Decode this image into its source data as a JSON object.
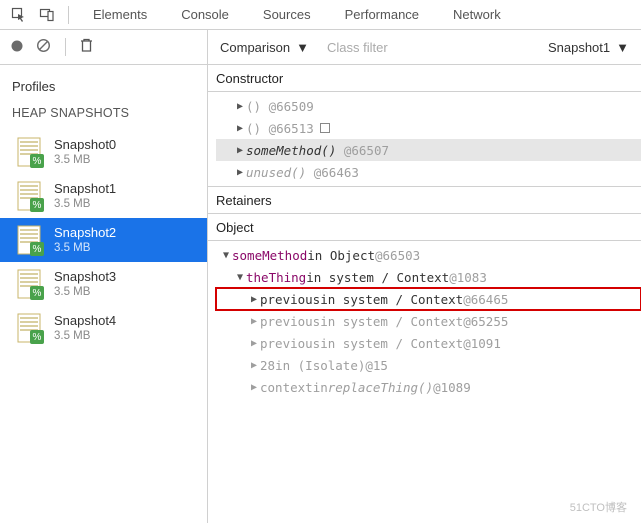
{
  "toolbar": {
    "tabs": [
      "Elements",
      "Console",
      "Sources",
      "Performance",
      "Network"
    ]
  },
  "contentToolbar": {
    "viewMode": "Comparison",
    "filterPlaceholder": "Class filter",
    "snapshotSelector": "Snapshot1"
  },
  "sidebar": {
    "profilesLabel": "Profiles",
    "heapLabel": "HEAP SNAPSHOTS",
    "snapshots": [
      {
        "name": "Snapshot0",
        "size": "3.5 MB",
        "selected": false
      },
      {
        "name": "Snapshot1",
        "size": "3.5 MB",
        "selected": false
      },
      {
        "name": "Snapshot2",
        "size": "3.5 MB",
        "selected": true
      },
      {
        "name": "Snapshot3",
        "size": "3.5 MB",
        "selected": false
      },
      {
        "name": "Snapshot4",
        "size": "3.5 MB",
        "selected": false
      }
    ]
  },
  "constructorSection": {
    "label": "Constructor",
    "rows": [
      {
        "indent": 1,
        "arrow": "▶",
        "name": "()",
        "suffix": "@66509",
        "gray": true
      },
      {
        "indent": 1,
        "arrow": "▶",
        "name": "()",
        "suffix": "@66513",
        "gray": true,
        "square": true
      },
      {
        "indent": 1,
        "arrow": "▶",
        "name": "someMethod()",
        "suffix": "@66507",
        "ital": true,
        "selected": true
      },
      {
        "indent": 1,
        "arrow": "▶",
        "name": "unused()",
        "suffix": "@66463",
        "gray": true,
        "ital": true
      }
    ]
  },
  "retainersSection": {
    "label": "Retainers",
    "objectLabel": "Object",
    "rows": [
      {
        "indent": 0,
        "arrow": "▼",
        "purple": "someMethod",
        "mid": " in Object ",
        "suffix": "@66503"
      },
      {
        "indent": 1,
        "arrow": "▼",
        "purple": "theThing",
        "mid": " in system / Context ",
        "suffix": "@1083"
      },
      {
        "indent": 2,
        "arrow": "▶",
        "plain": "previous",
        "mid": " in system / Context ",
        "suffix": "@66465",
        "red": true
      },
      {
        "indent": 2,
        "arrow": "▶",
        "plain": "previous",
        "mid": " in system / Context ",
        "suffix": "@65255",
        "gray": true
      },
      {
        "indent": 2,
        "arrow": "▶",
        "plain": "previous",
        "mid": " in system / Context ",
        "suffix": "@1091",
        "gray": true
      },
      {
        "indent": 2,
        "arrow": "▶",
        "plain": "28",
        "mid": " in (Isolate) ",
        "suffix": "@15",
        "gray": true
      },
      {
        "indent": 2,
        "arrow": "▶",
        "plain": "context",
        "mid": " in ",
        "ital": "replaceThing()",
        "suffix": " @1089",
        "gray": true
      }
    ]
  },
  "watermark": "51CTO博客"
}
